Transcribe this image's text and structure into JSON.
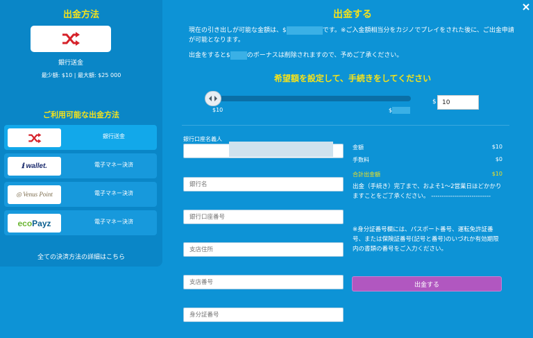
{
  "sidebar": {
    "title": "出金方法",
    "selected_name": "銀行送金",
    "limits": "最少額: $10 | 最大額: $25 000",
    "available_title": "ご利用可能な出金方法",
    "methods": [
      {
        "logo": "shuffle-icon",
        "label": "銀行送金"
      },
      {
        "logo": "iwallet",
        "label": "電子マネー決済"
      },
      {
        "logo": "VenusPoint",
        "label": "電子マネー決済"
      },
      {
        "logo": "ecoPayz",
        "label": "電子マネー決済"
      }
    ],
    "all_methods_link": "全ての決済方法の詳細はこちら"
  },
  "main": {
    "title": "出金する",
    "info_line1_a": "現在の引き出しが可能な金額は、$",
    "info_line1_b": "です。※ご入金額相当分をカジノでプレイをされた後に、ご出金申請が可能となります。",
    "info_line2_a": "出金をすると$",
    "info_line2_b": "のボーナスは削除されますので、予めご了承ください。",
    "hint": "希望額を設定して、手続きをしてください",
    "slider_min": "$10",
    "slider_max": "$",
    "currency": "$",
    "amount": "10",
    "close": "×"
  },
  "form": {
    "name_label": "銀行口座名義人",
    "bank_name": "銀行名",
    "account_number": "銀行口座番号",
    "branch_address": "支店住所",
    "branch_number": "支店番号",
    "id_number": "身分証番号"
  },
  "summary": {
    "amount_label": "金額",
    "amount_value": "$10",
    "fee_label": "手数料",
    "fee_value": "$0",
    "total_label": "合計出金額",
    "total_value": "$10",
    "note": "出金（手続き）完了まで、およそ1〜2営業日ほどかかりますことをご了承ください。 ----------------------------",
    "id_note": "※身分証番号欄には、パスポート番号、運転免許証番号、または保険証番号(記号と番号)のいづれか有効期限内の書類の番号をご入力ください。",
    "submit": "出金する"
  },
  "colors": {
    "accent": "#f5e21b",
    "background": "#0d93d6",
    "button": "#b157c0",
    "shuffle_icon": "#d6222a"
  }
}
